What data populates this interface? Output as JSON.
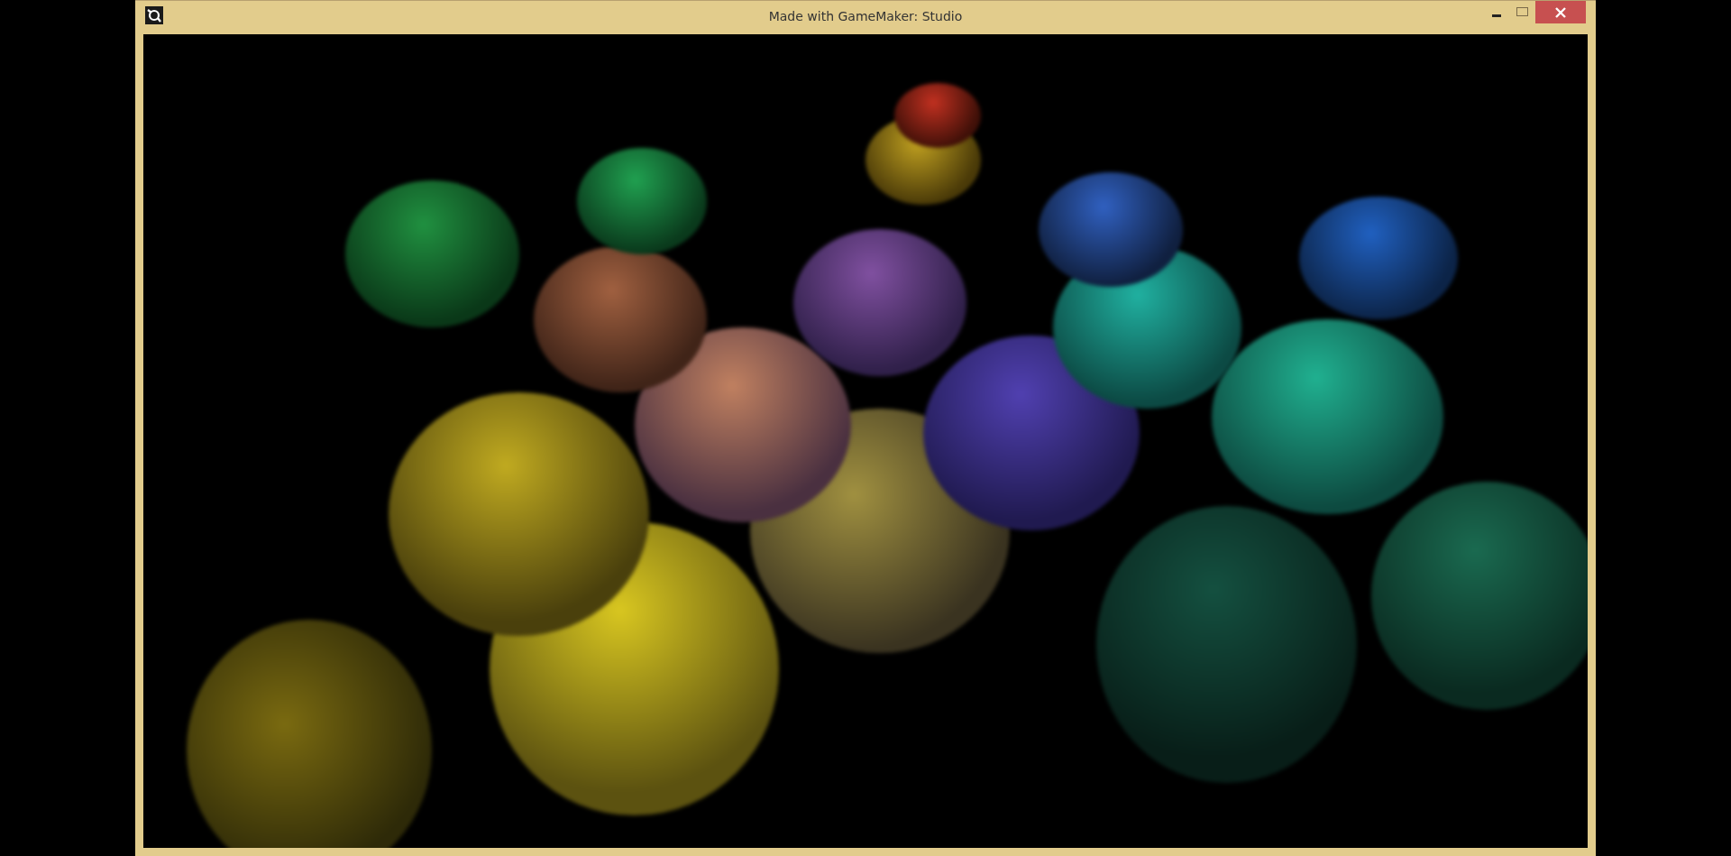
{
  "window": {
    "title": "Made with GameMaker: Studio"
  }
}
